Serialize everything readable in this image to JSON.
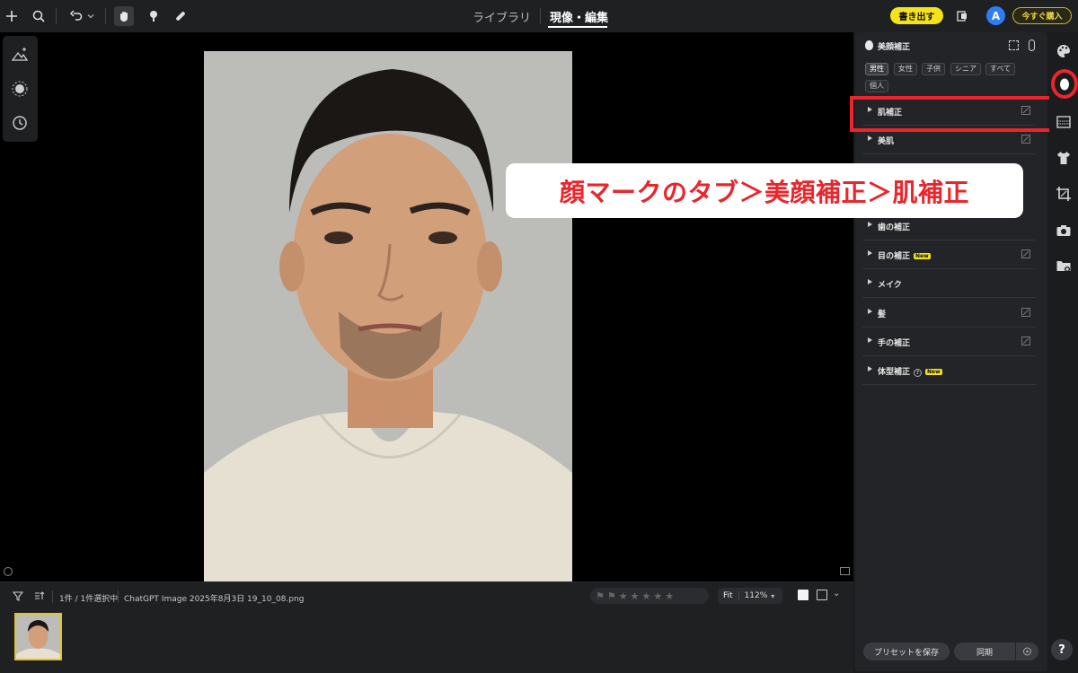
{
  "topbar": {
    "tabs": [
      {
        "label": "ライブラリ",
        "active": false
      },
      {
        "label": "現像・編集",
        "active": true
      }
    ],
    "export_label": "書き出す",
    "avatar_letter": "A",
    "buy_label": "今すぐ購入",
    "icons": [
      "plus-icon",
      "search-icon",
      "undo-icon",
      "chevron-down-icon",
      "hand-icon",
      "brush-icon",
      "bandage-icon",
      "compare-icon"
    ]
  },
  "left_tools": [
    "auto-enhance-icon",
    "light-icon",
    "history-icon"
  ],
  "filmstrip": {
    "selection_text": "1件 / 1件選択中",
    "filename": "ChatGPT Image 2025年8月3日 19_10_08.png",
    "fit_label": "Fit",
    "zoom_label": "112%",
    "rating_stars": 5
  },
  "panel": {
    "title": "美顔補正",
    "chips": [
      {
        "label": "男性",
        "selected": true
      },
      {
        "label": "女性",
        "selected": false
      },
      {
        "label": "子供",
        "selected": false
      },
      {
        "label": "シニア",
        "selected": false
      },
      {
        "label": "すべて",
        "selected": false
      },
      {
        "label": "個人",
        "selected": false
      }
    ],
    "rows": [
      {
        "label": "肌補正"
      },
      {
        "label": "美肌"
      },
      {
        "label": "歯の補正"
      },
      {
        "label": "目の補正",
        "badge": "New"
      },
      {
        "label": "メイク"
      },
      {
        "label": "髪"
      },
      {
        "label": "手の補正"
      },
      {
        "label": "体型補正",
        "badge": "New",
        "help": "?"
      }
    ],
    "preset_label": "プリセットを保存",
    "sync_label": "同期"
  },
  "callout": "顔マークのタブ＞美顔補正＞肌補正",
  "right_rail_icons": [
    "palette-icon",
    "face-icon",
    "gradient-icon",
    "shirt-icon",
    "crop-icon",
    "camera-icon",
    "folder-settings-icon"
  ],
  "help_label": "?",
  "colors": {
    "accent_yellow": "#f5e31a",
    "highlight_red": "#e8262b",
    "avatar_blue": "#2f7df6"
  }
}
